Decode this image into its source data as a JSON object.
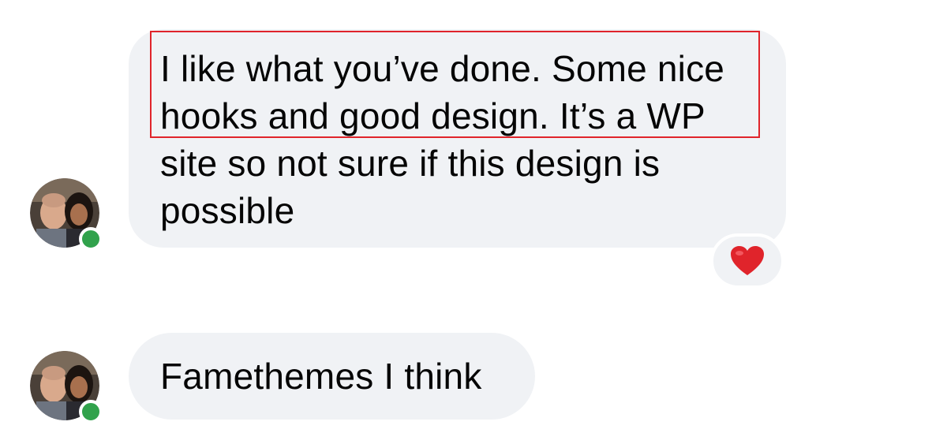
{
  "messages": [
    {
      "sender": "contact",
      "lines": [
        "I like what you’ve done. Some nice",
        "hooks and good design. It’s a WP",
        "site so not sure if this design is",
        "possible"
      ],
      "reaction": {
        "icon": "heart-icon",
        "color": "#e0242b"
      },
      "highlighted_lines": [
        0,
        1
      ],
      "highlight_color": "#e0242b"
    },
    {
      "sender": "contact",
      "text": "Famethemes I think"
    }
  ],
  "theme": {
    "bubble_color": "#f0f2f5",
    "text_color": "#050505",
    "presence_color": "#31a24c"
  }
}
